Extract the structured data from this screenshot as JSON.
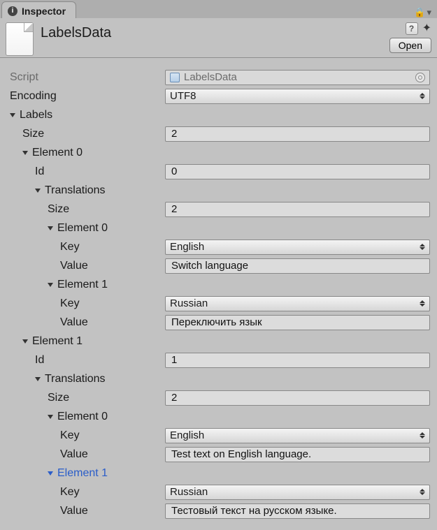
{
  "tab": {
    "title": "Inspector"
  },
  "lock": {
    "glyph": "🔒",
    "menu_glyph": "▾"
  },
  "asset": {
    "title": "LabelsData",
    "help_glyph": "?",
    "gear_glyph": "✦",
    "open_label": "Open"
  },
  "fields": {
    "script": {
      "label": "Script",
      "value": "LabelsData"
    },
    "encoding": {
      "label": "Encoding",
      "value": "UTF8"
    },
    "labels_section": {
      "label": "Labels"
    },
    "size_label": "Size",
    "id_label": "Id",
    "translations_label": "Translations",
    "key_label": "Key",
    "value_label": "Value",
    "element_label_prefix": "Element "
  },
  "labels": {
    "size": "2",
    "items": [
      {
        "name": "Element 0",
        "id": "0",
        "translations": {
          "size": "2",
          "items": [
            {
              "name": "Element 0",
              "key": "English",
              "value": "Switch language"
            },
            {
              "name": "Element 1",
              "key": "Russian",
              "value": "Переключить язык"
            }
          ]
        }
      },
      {
        "name": "Element 1",
        "id": "1",
        "translations": {
          "size": "2",
          "items": [
            {
              "name": "Element 0",
              "key": "English",
              "value": "Test text on English language."
            },
            {
              "name": "Element 1",
              "key": "Russian",
              "value": "Тестовый текст на русском языке.",
              "selected": true
            }
          ]
        }
      }
    ]
  }
}
